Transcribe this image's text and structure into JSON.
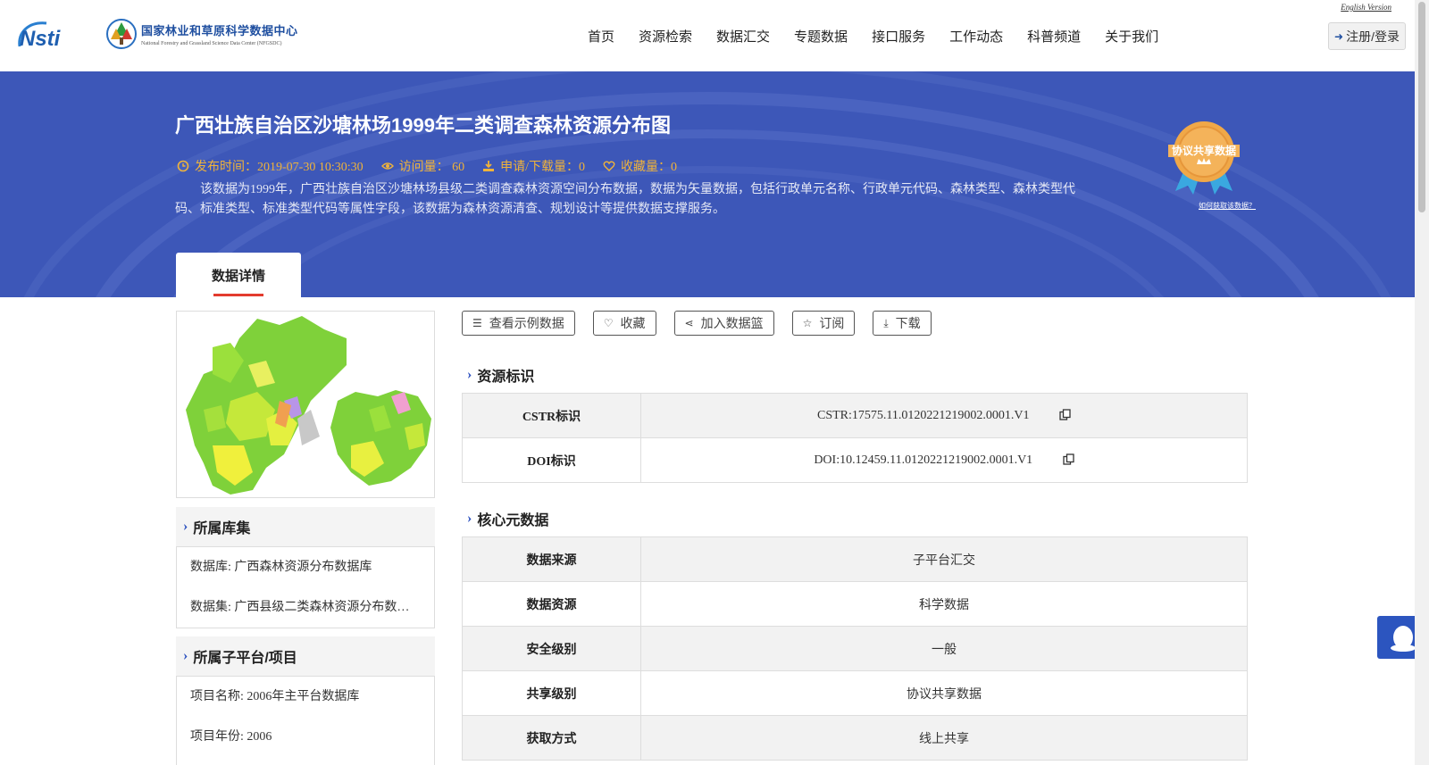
{
  "header": {
    "logo_nsti": "Nsti",
    "logo_center_cn": "国家林业和草原科学数据中心",
    "logo_center_en": "National Forestry and Grassland Science Data Center (NFGSDC)",
    "english_link": "English Version",
    "nav": [
      "首页",
      "资源检索",
      "数据汇交",
      "专题数据",
      "接口服务",
      "工作动态",
      "科普频道",
      "关于我们"
    ],
    "login_label": "注册/登录"
  },
  "banner": {
    "title": "广西壮族自治区沙塘林场1999年二类调查森林资源分布图",
    "publish_time": "发布时间：2019-07-30 10:30:30",
    "visits": "访问量： 60",
    "downloads": "申请/下载量：0",
    "favorites": "收藏量：0",
    "description": "该数据为1999年，广西壮族自治区沙塘林场县级二类调查森林资源空间分布数据，数据为矢量数据，包括行政单元名称、行政单元代码、森林类型、森林类型代码、标准类型、标准类型代码等属性字段，该数据为森林资源清查、规划设计等提供数据支撑服务。",
    "badge_text": "协议共享数据",
    "badge_link": "如何获取该数据？",
    "tab_label": "数据详情"
  },
  "actions": [
    "查看示例数据",
    "收藏",
    "加入数据篮",
    "订阅",
    "下载"
  ],
  "sidebar": {
    "collection_title": "所属库集",
    "database": "数据库: 广西森林资源分布数据库",
    "dataset": "数据集: 广西县级二类森林资源分布数据集",
    "platform_title": "所属子平台/项目",
    "project_name": "项目名称: 2006年主平台数据库",
    "project_year": "项目年份: 2006"
  },
  "resource_id": {
    "title": "资源标识",
    "rows": [
      {
        "key": "CSTR标识",
        "value": "CSTR:17575.11.0120221219002.0001.V1"
      },
      {
        "key": "DOI标识",
        "value": "DOI:10.12459.11.0120221219002.0001.V1"
      }
    ]
  },
  "core_meta": {
    "title": "核心元数据",
    "rows": [
      {
        "key": "数据来源",
        "value": "子平台汇交"
      },
      {
        "key": "数据资源",
        "value": "科学数据"
      },
      {
        "key": "安全级别",
        "value": "一般"
      },
      {
        "key": "共享级别",
        "value": "协议共享数据"
      },
      {
        "key": "获取方式",
        "value": "线上共享"
      }
    ]
  },
  "colors": {
    "banner_bg": "#3d57b8",
    "meta_text": "#f0b33a",
    "accent_blue": "#2a4fbf",
    "tab_underline": "#e33b2e"
  }
}
